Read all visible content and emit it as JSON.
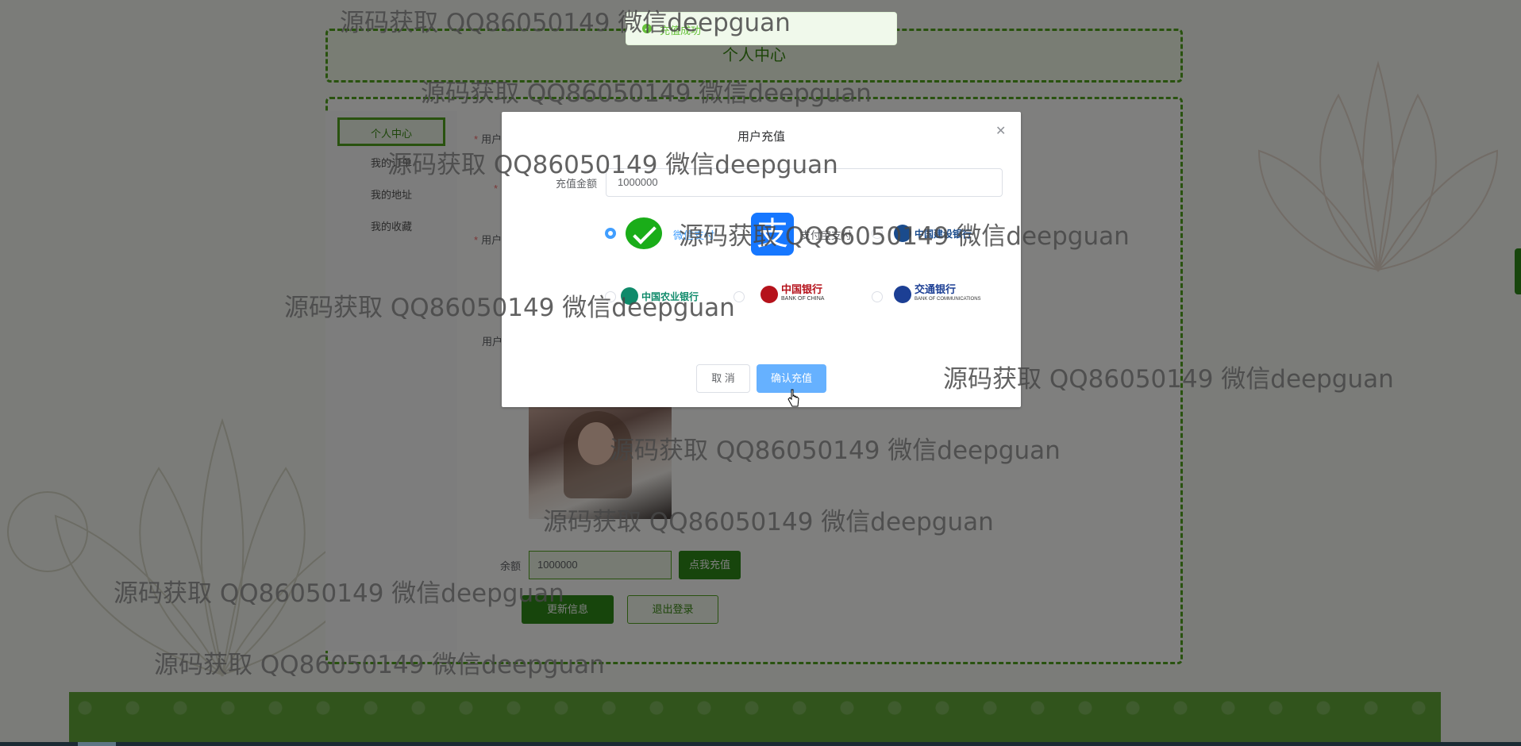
{
  "page": {
    "header_title": "个人中心"
  },
  "sidebar": {
    "items": [
      {
        "label": "个人中心",
        "active": true
      },
      {
        "label": "我的订单"
      },
      {
        "label": "我的地址"
      },
      {
        "label": "我的收藏"
      }
    ]
  },
  "form": {
    "labels": [
      "用户",
      "用户",
      "用户"
    ],
    "balance_label": "余额",
    "balance_value": "1000000",
    "recharge_button": "点我充值",
    "update_button": "更新信息",
    "logout_button": "退出登录"
  },
  "toast": {
    "message": "充值成功",
    "icon": "check-circle-icon"
  },
  "dialog": {
    "title": "用户充值",
    "amount_label": "充值金额",
    "amount_value": "1000000",
    "payment_methods": [
      {
        "label": "微信支付",
        "selected": true,
        "icon": "wechat-pay-logo"
      },
      {
        "label": "支付宝支付",
        "selected": false,
        "icon": "alipay-logo"
      },
      {
        "label": "中国建设银行",
        "selected": false,
        "icon": "ccb-logo"
      },
      {
        "label": "中国农业银行",
        "selected": false,
        "icon": "abc-logo"
      },
      {
        "label": "中国银行",
        "sub": "BANK OF CHINA",
        "selected": false,
        "icon": "boc-logo"
      },
      {
        "label": "交通银行",
        "sub": "BANK OF COMMUNICATIONS",
        "selected": false,
        "icon": "bocom-logo"
      }
    ],
    "cancel_button": "取 消",
    "confirm_button": "确认充值"
  },
  "watermark": "源码获取 QQ86050149 微信deepguan",
  "colors": {
    "brand_green": "#53a51f",
    "dark_green": "#2f8a19",
    "primary_blue": "#409eff",
    "success_green": "#67c23a"
  }
}
